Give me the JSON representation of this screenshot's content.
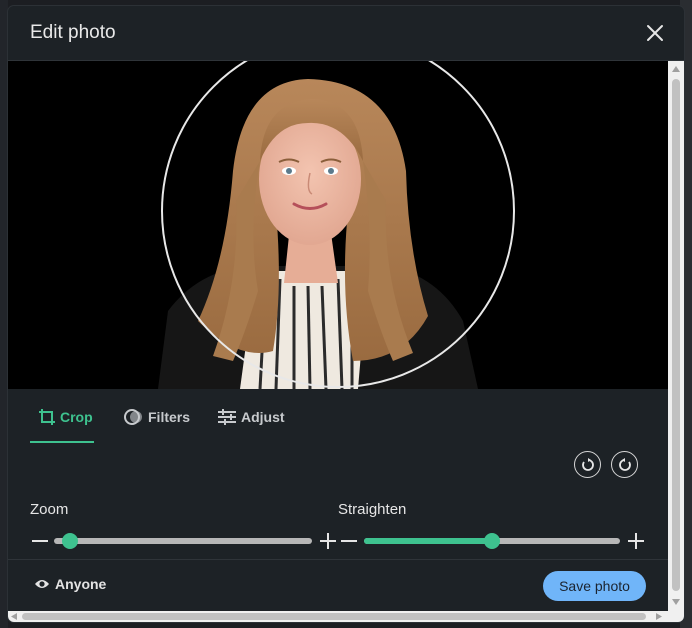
{
  "modal": {
    "title": "Edit photo",
    "close_icon": "close-icon"
  },
  "tabs": [
    {
      "label": "Crop",
      "icon": "crop-icon",
      "active": true
    },
    {
      "label": "Filters",
      "icon": "filters-icon",
      "active": false
    },
    {
      "label": "Adjust",
      "icon": "adjust-icon",
      "active": false
    }
  ],
  "rotate": {
    "left_icon": "rotate-left-icon",
    "right_icon": "rotate-right-icon"
  },
  "zoom": {
    "label": "Zoom",
    "value": 0.0
  },
  "straighten": {
    "label": "Straighten",
    "value": 0.5
  },
  "footer": {
    "visibility_label": "Anyone",
    "visibility_icon": "eye-icon",
    "save_label": "Save photo"
  },
  "colors": {
    "accent": "#3ec28f",
    "primary_button": "#70b5f9",
    "modal_bg": "#1d2226"
  }
}
